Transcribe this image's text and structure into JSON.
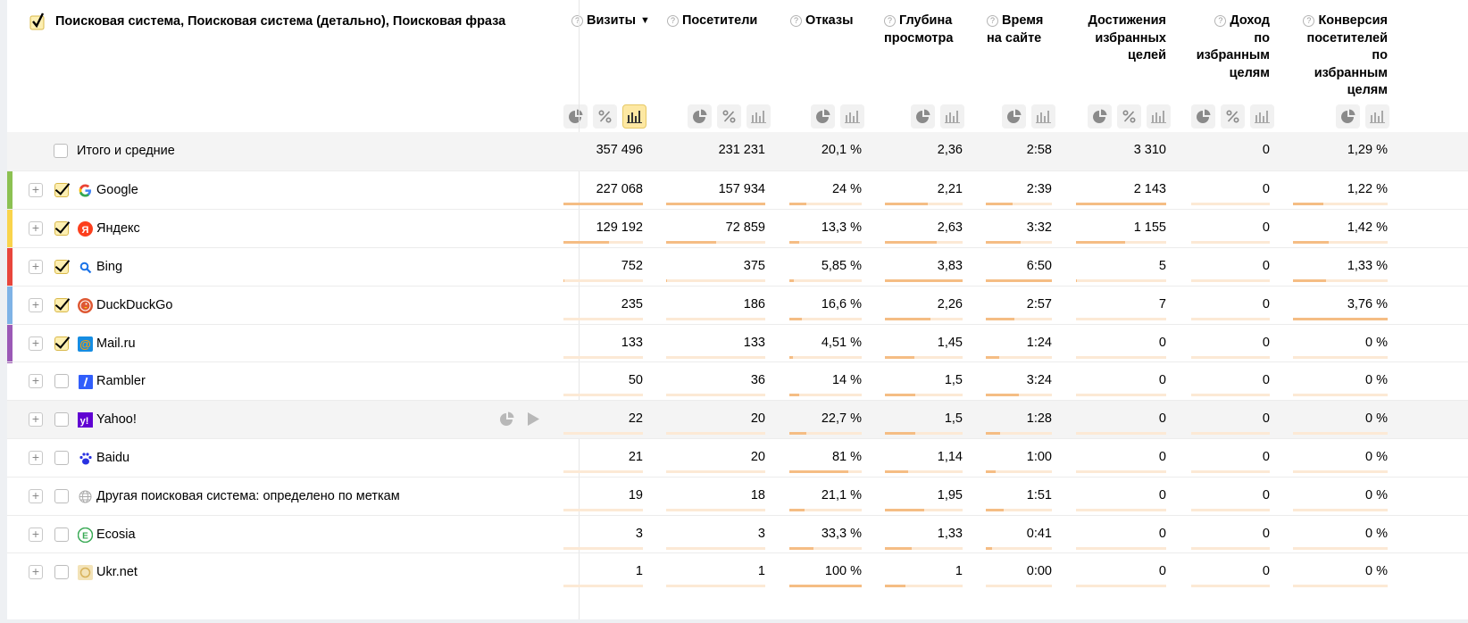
{
  "header": {
    "dimension_title": "Поисковая система, Поисковая система (детально), Поисковая фраза",
    "sort_arrow": "▼"
  },
  "columns": [
    {
      "lines": [
        "Визиты"
      ],
      "help": true,
      "sorted": true
    },
    {
      "lines": [
        "Посетители"
      ],
      "help": true
    },
    {
      "lines": [
        "Отказы"
      ],
      "help": true
    },
    {
      "lines": [
        "Глубина",
        "просмотра"
      ],
      "help": true
    },
    {
      "lines": [
        "Время",
        "на сайте"
      ],
      "help": true
    },
    {
      "lines": [
        "Достижения",
        "избранных",
        "целей"
      ],
      "help": false
    },
    {
      "lines": [
        "Доход",
        "по",
        "избранным",
        "целям"
      ],
      "help": true
    },
    {
      "lines": [
        "Конверсия",
        "посетителей",
        "по",
        "избранным",
        "целям"
      ],
      "help": true
    }
  ],
  "column_icons": [
    [
      "pie-chart",
      "percent",
      "bar-chart-active"
    ],
    [
      "pie-chart",
      "percent",
      "bar-chart"
    ],
    [
      "pie-chart",
      "bar-chart"
    ],
    [
      "pie-chart",
      "bar-chart"
    ],
    [
      "pie-chart",
      "bar-chart"
    ],
    [
      "pie-chart",
      "percent",
      "bar-chart"
    ],
    [
      "pie-chart",
      "percent",
      "bar-chart"
    ],
    [
      "pie-chart",
      "bar-chart"
    ]
  ],
  "total": {
    "label": "Итого и средние",
    "values": [
      "357 496",
      "231 231",
      "20,1 %",
      "2,36",
      "2:58",
      "3 310",
      "0",
      "1,29 %"
    ]
  },
  "rows": [
    {
      "name": "Google",
      "logo": "google-logo",
      "checked": true,
      "color": "#8cc152",
      "values": [
        "227 068",
        "157 934",
        "24 %",
        "2,21",
        "2:39",
        "2 143",
        "0",
        "1,22 %"
      ],
      "bars": [
        1.0,
        1.0,
        0.24,
        0.55,
        0.4,
        1.0,
        0,
        0.32
      ]
    },
    {
      "name": "Яндекс",
      "logo": "yandex-logo",
      "checked": true,
      "color": "#f9d44c",
      "values": [
        "129 192",
        "72 859",
        "13,3 %",
        "2,63",
        "3:32",
        "1 155",
        "0",
        "1,42 %"
      ],
      "bars": [
        0.57,
        0.5,
        0.14,
        0.67,
        0.53,
        0.54,
        0,
        0.38
      ]
    },
    {
      "name": "Bing",
      "logo": "bing-logo",
      "checked": true,
      "color": "#e8453c",
      "values": [
        "752",
        "375",
        "5,85 %",
        "3,83",
        "6:50",
        "5",
        "0",
        "1,33 %"
      ],
      "bars": [
        0.01,
        0.01,
        0.06,
        1.0,
        1.0,
        0.01,
        0,
        0.35
      ]
    },
    {
      "name": "DuckDuckGo",
      "logo": "duckduckgo-logo",
      "checked": true,
      "color": "#7fb3e6",
      "values": [
        "235",
        "186",
        "16,6 %",
        "2,26",
        "2:57",
        "7",
        "0",
        "3,76 %"
      ],
      "bars": [
        0.0,
        0.0,
        0.17,
        0.59,
        0.43,
        0.0,
        0,
        1.0
      ]
    },
    {
      "name": "Mail.ru",
      "logo": "mailru-logo",
      "checked": true,
      "color": "#9b59b6",
      "values": [
        "133",
        "133",
        "4,51 %",
        "1,45",
        "1:24",
        "0",
        "0",
        "0 %"
      ],
      "bars": [
        0,
        0,
        0.05,
        0.38,
        0.2,
        0,
        0,
        0
      ]
    },
    {
      "name": "Rambler",
      "logo": "rambler-logo",
      "checked": false,
      "color": "",
      "values": [
        "50",
        "36",
        "14 %",
        "1,5",
        "3:24",
        "0",
        "0",
        "0 %"
      ],
      "bars": [
        0,
        0,
        0.14,
        0.39,
        0.5,
        0,
        0,
        0
      ]
    },
    {
      "name": "Yahoo!",
      "logo": "yahoo-logo",
      "checked": false,
      "color": "",
      "hover": true,
      "values": [
        "22",
        "20",
        "22,7 %",
        "1,5",
        "1:28",
        "0",
        "0",
        "0 %"
      ],
      "bars": [
        0,
        0,
        0.23,
        0.39,
        0.21,
        0,
        0,
        0
      ]
    },
    {
      "name": "Baidu",
      "logo": "baidu-logo",
      "checked": false,
      "color": "",
      "values": [
        "21",
        "20",
        "81 %",
        "1,14",
        "1:00",
        "0",
        "0",
        "0 %"
      ],
      "bars": [
        0,
        0,
        0.81,
        0.3,
        0.15,
        0,
        0,
        0
      ]
    },
    {
      "name": "Другая поисковая система: определено по меткам",
      "logo": "globe-icon",
      "checked": false,
      "color": "",
      "values": [
        "19",
        "18",
        "21,1 %",
        "1,95",
        "1:51",
        "0",
        "0",
        "0 %"
      ],
      "bars": [
        0,
        0,
        0.21,
        0.51,
        0.27,
        0,
        0,
        0
      ]
    },
    {
      "name": "Ecosia",
      "logo": "ecosia-logo",
      "checked": false,
      "color": "",
      "values": [
        "3",
        "3",
        "33,3 %",
        "1,33",
        "0:41",
        "0",
        "0",
        "0 %"
      ],
      "bars": [
        0,
        0,
        0.33,
        0.35,
        0.1,
        0,
        0,
        0
      ]
    },
    {
      "name": "Ukr.net",
      "logo": "ukrnet-logo",
      "checked": false,
      "color": "",
      "values": [
        "1",
        "1",
        "100 %",
        "1",
        "0:00",
        "0",
        "0",
        "0 %"
      ],
      "bars": [
        0,
        0,
        1.0,
        0.26,
        0.0,
        0,
        0,
        0
      ]
    }
  ]
}
